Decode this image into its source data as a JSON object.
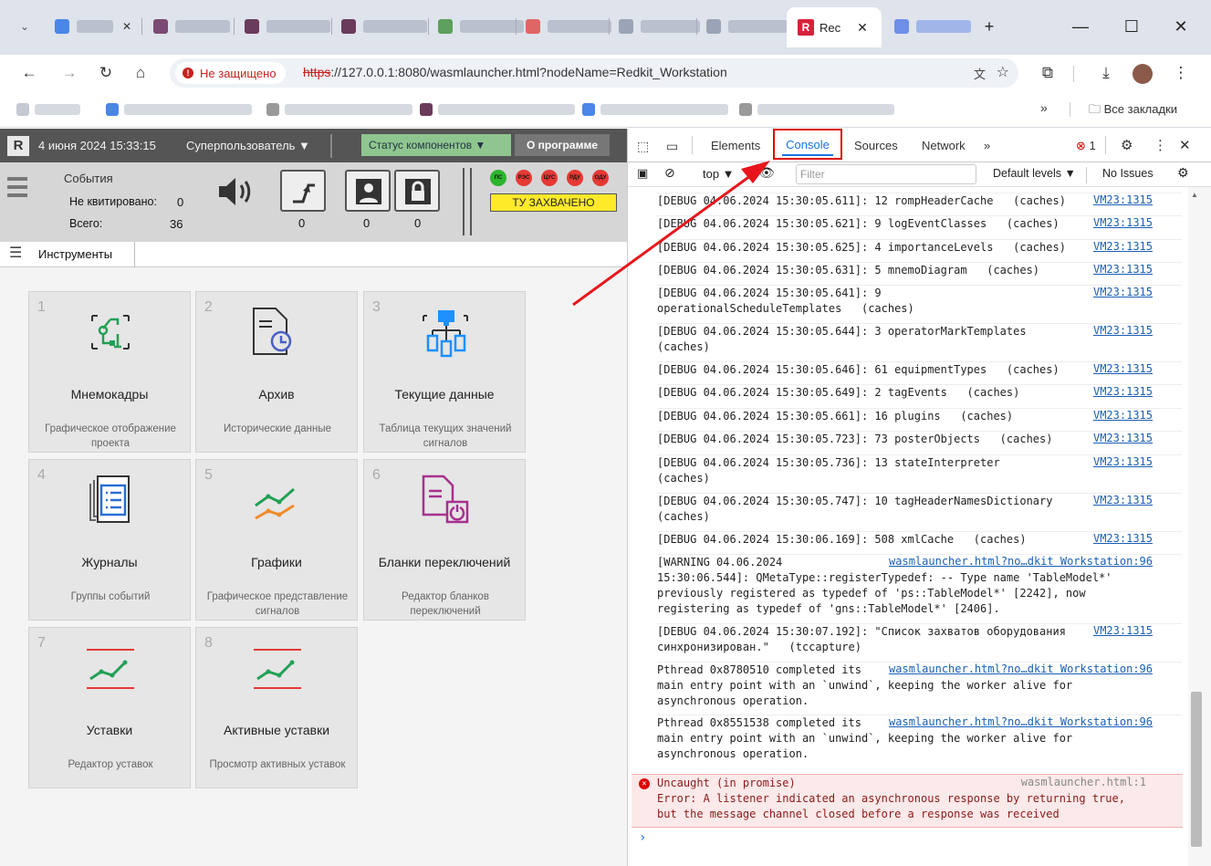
{
  "browser": {
    "active_tab_title": "Rec",
    "url_security": "Не защищено",
    "url_scheme": "https",
    "url_rest": "://127.0.0.1:8080/wasmlauncher.html?nodeName=Redkit_Workstation",
    "bookmarks_more": "»",
    "all_bookmarks": "Все закладки"
  },
  "app": {
    "logo": "R",
    "date": "4 июня 2024   15:33:15",
    "user": "Суперпользователь ▼",
    "status_components": "Статус компонентов  ▼",
    "about": "О программе",
    "events_title": "События",
    "unacked_label": "Не квитировано:",
    "unacked_value": "0",
    "total_label": "Всего:",
    "total_value": "36",
    "counts": [
      "0",
      "0",
      "0"
    ],
    "leds": [
      "ПС",
      "РЭС",
      "ЦУС",
      "РДУ",
      "ОДУ"
    ],
    "tu_status": "ТУ ЗАХВАЧЕНО",
    "tools_label": "Инструменты",
    "tiles": [
      {
        "num": "1",
        "title": "Мнемокадры",
        "sub": "Графическое отображение проекта",
        "icon": "mnemo-icon"
      },
      {
        "num": "2",
        "title": "Архив",
        "sub": "Исторические данные",
        "icon": "archive-icon"
      },
      {
        "num": "3",
        "title": "Текущие данные",
        "sub": "Таблица текущих значений сигналов",
        "icon": "current-data-icon"
      },
      {
        "num": "4",
        "title": "Журналы",
        "sub": "Группы событий",
        "icon": "journal-icon"
      },
      {
        "num": "5",
        "title": "Графики",
        "sub": "Графическое представление сигналов",
        "icon": "chart-icon"
      },
      {
        "num": "6",
        "title": "Бланки переключений",
        "sub": "Редактор бланков переключений",
        "icon": "switch-form-icon"
      },
      {
        "num": "7",
        "title": "Уставки",
        "sub": "Редактор уставок",
        "icon": "setpoint-icon"
      },
      {
        "num": "8",
        "title": "Активные уставки",
        "sub": "Просмотр активных уставок",
        "icon": "active-setpoint-icon"
      }
    ]
  },
  "devtools": {
    "tabs": [
      "Elements",
      "Console",
      "Sources",
      "Network",
      "»"
    ],
    "error_count": "1",
    "context": "top ▼",
    "filter_placeholder": "Filter",
    "levels": "Default levels ▼",
    "issues": "No Issues",
    "messages": [
      {
        "text": "[DEBUG 04.06.2024 15:30:05.611]: 12 rompHeaderCache   (caches)",
        "src": "VM23:1315"
      },
      {
        "text": "[DEBUG 04.06.2024 15:30:05.621]: 9 logEventClasses   (caches)",
        "src": "VM23:1315"
      },
      {
        "text": "[DEBUG 04.06.2024 15:30:05.625]: 4 importanceLevels   (caches)",
        "src": "VM23:1315"
      },
      {
        "text": "[DEBUG 04.06.2024 15:30:05.631]: 5 mnemoDiagram   (caches)",
        "src": "VM23:1315"
      },
      {
        "text": "[DEBUG 04.06.2024 15:30:05.641]: 9\noperationalScheduleTemplates   (caches)",
        "src": "VM23:1315"
      },
      {
        "text": "[DEBUG 04.06.2024 15:30:05.644]: 3 operatorMarkTemplates\n(caches)",
        "src": "VM23:1315"
      },
      {
        "text": "[DEBUG 04.06.2024 15:30:05.646]: 61 equipmentTypes   (caches)",
        "src": "VM23:1315"
      },
      {
        "text": "[DEBUG 04.06.2024 15:30:05.649]: 2 tagEvents   (caches)",
        "src": "VM23:1315"
      },
      {
        "text": "[DEBUG 04.06.2024 15:30:05.661]: 16 plugins   (caches)",
        "src": "VM23:1315"
      },
      {
        "text": "[DEBUG 04.06.2024 15:30:05.723]: 73 posterObjects   (caches)",
        "src": "VM23:1315"
      },
      {
        "text": "[DEBUG 04.06.2024 15:30:05.736]: 13 stateInterpreter\n(caches)",
        "src": "VM23:1315"
      },
      {
        "text": "[DEBUG 04.06.2024 15:30:05.747]: 10 tagHeaderNamesDictionary\n(caches)",
        "src": "VM23:1315"
      },
      {
        "text": "[DEBUG 04.06.2024 15:30:06.169]: 508 xmlCache   (caches)",
        "src": "VM23:1315"
      },
      {
        "text": "[WARNING 04.06.2024\n15:30:06.544]: QMetaType::registerTypedef: -- Type name 'TableModel*'\npreviously registered as typedef of 'ps::TableModel*' [2242], now\nregistering as typedef of 'gns::TableModel*' [2406].",
        "src": "wasmlauncher.html?no…dkit Workstation:96"
      },
      {
        "text": "[DEBUG 04.06.2024 15:30:07.192]: \"Список захватов оборудования\nсинхронизирован.\"   (tccapture)",
        "src": "VM23:1315"
      },
      {
        "text": "Pthread 0x8780510 completed its\nmain entry point with an `unwind`, keeping the worker alive for\nasynchronous operation.",
        "src": "wasmlauncher.html?no…dkit Workstation:96"
      },
      {
        "text": "Pthread 0x8551538 completed its\nmain entry point with an `unwind`, keeping the worker alive for\nasynchronous operation.",
        "src": "wasmlauncher.html?no…dkit Workstation:96"
      }
    ],
    "error": {
      "text": "Uncaught (in promise)\nError: A listener indicated an asynchronous response by returning true,\nbut the message channel closed before a response was received",
      "src": "wasmlauncher.html:1"
    },
    "prompt": "›"
  }
}
